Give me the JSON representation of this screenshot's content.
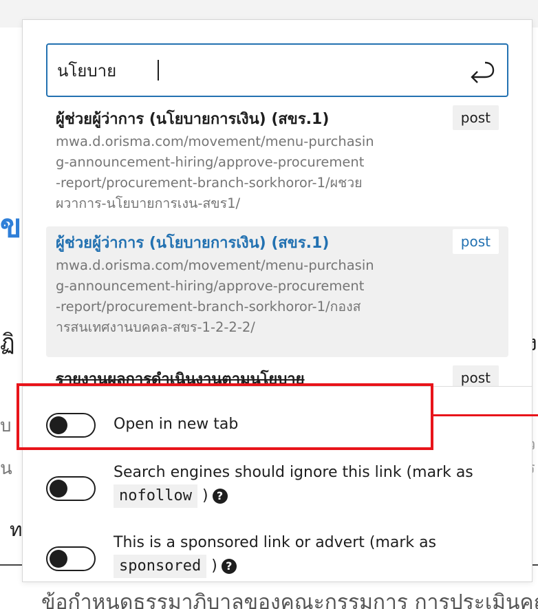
{
  "background": {
    "glyph_blue": "ข",
    "glyph_left1": "ฏิ",
    "glyph_left2": "บ",
    "glyph_left3": "น",
    "glyph_left4": "ท",
    "glyph_right1": "ง",
    "glyph_right2": "ว",
    "glyph_right3": "ร",
    "bottom_text": "ข้อกำหนดธรรมาภิบาลของคณะกรรมการ การประเมินคุณภาพ"
  },
  "search": {
    "value": "นโยบาย",
    "submit_icon": "enter-return-icon"
  },
  "results": [
    {
      "title": "ผู้ช่วยผู้ว่าการ (นโยบายการเงิน) (สขร.1)",
      "type": "post",
      "url_lines": [
        "mwa.d.orisma.com/movement/menu-purchasin",
        "g-announcement-hiring/approve-procurement",
        "-report/procurement-branch-sorkhoror-1/ผชวย",
        "ผวาการ-นโยบายการเงน-สขร1/"
      ]
    },
    {
      "title": "ผู้ช่วยผู้ว่าการ (นโยบายการเงิน) (สขร.1)",
      "type": "post",
      "url_lines": [
        "mwa.d.orisma.com/movement/menu-purchasin",
        "g-announcement-hiring/approve-procurement",
        "-report/procurement-branch-sorkhoror-1/กองส",
        "ารสนเทศงานบคคล-สขร-1-2-2-2/"
      ]
    },
    {
      "title": "รายงานผลการดำเนินงานตามนโยบาย",
      "type": "post"
    }
  ],
  "settings": {
    "new_tab": {
      "label": "Open in new tab",
      "checked": false
    },
    "nofollow": {
      "label_before": "Search engines should ignore this link (mark as",
      "code": "nofollow",
      "label_after": ")",
      "checked": false,
      "help_icon": "?"
    },
    "sponsored": {
      "label_before": "This is a sponsored link or advert (mark as",
      "code": "sponsored",
      "label_after": ")",
      "checked": false,
      "help_icon": "?"
    }
  },
  "colors": {
    "accent": "#2271b1",
    "annotation": "#e8141a",
    "muted_text": "#757575",
    "selected_bg": "#f0f0f0"
  }
}
